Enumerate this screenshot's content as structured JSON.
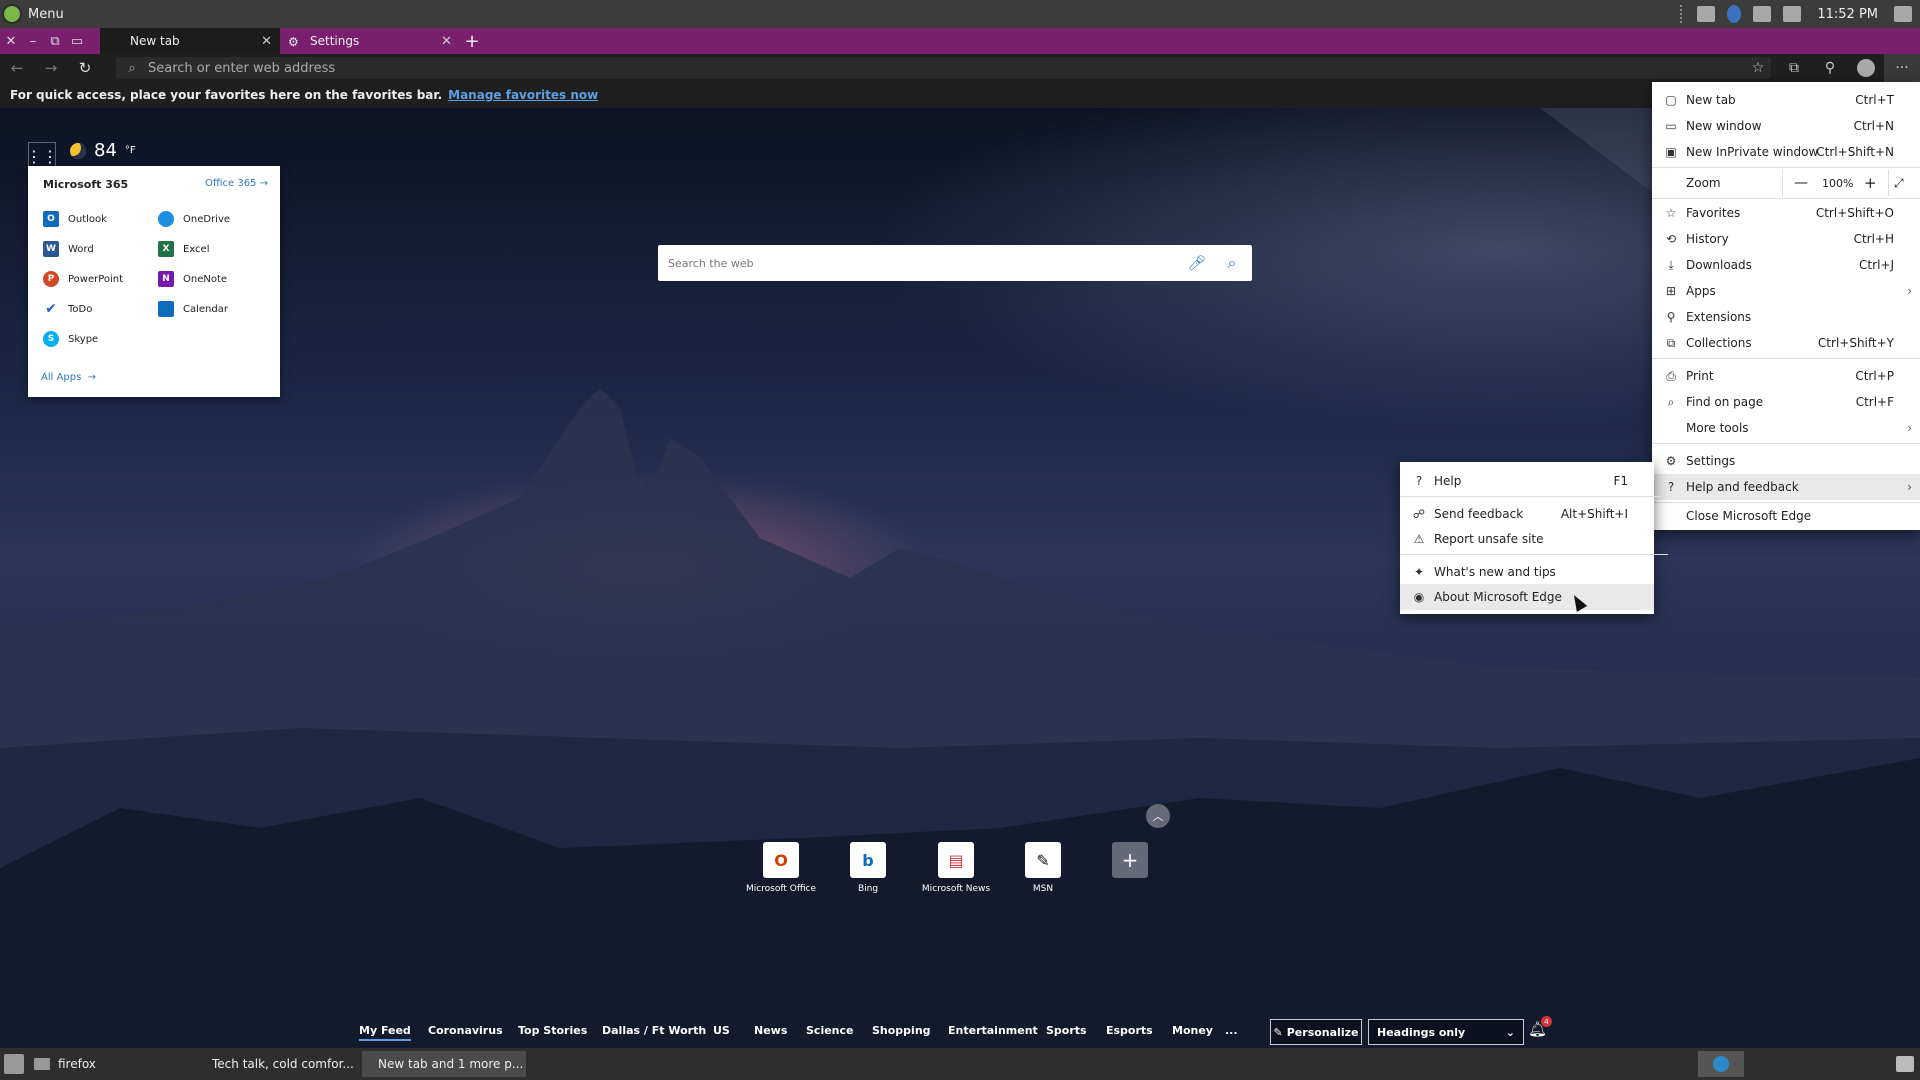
{
  "system": {
    "menu_label": "Menu",
    "clock": "11:52 PM"
  },
  "tabs": [
    {
      "label": "New tab"
    },
    {
      "label": "Settings"
    }
  ],
  "toolbar": {
    "address_placeholder": "Search or enter web address"
  },
  "favbar": {
    "text": "For quick access, place your favorites here on the favorites bar.",
    "link": "Manage favorites now"
  },
  "weather": {
    "temp": "84",
    "unit": "°F"
  },
  "m365": {
    "title": "Microsoft 365",
    "office_link": "Office 365",
    "apps": [
      {
        "label": "Outlook",
        "color": "#0f6cbd"
      },
      {
        "label": "OneDrive",
        "color": "#1c8fe0"
      },
      {
        "label": "Word",
        "color": "#2b5797"
      },
      {
        "label": "Excel",
        "color": "#217346"
      },
      {
        "label": "PowerPoint",
        "color": "#d24726"
      },
      {
        "label": "OneNote",
        "color": "#7719aa"
      },
      {
        "label": "ToDo",
        "color": "#2564cf"
      },
      {
        "label": "Calendar",
        "color": "#0f6cbd"
      },
      {
        "label": "Skype",
        "color": "#00aff0"
      }
    ],
    "all_apps": "All Apps"
  },
  "websearch": {
    "placeholder": "Search the web"
  },
  "quick_links": [
    {
      "label": "Microsoft Office",
      "color": "#d83b01"
    },
    {
      "label": "Bing",
      "color": "#0f6cbd"
    },
    {
      "label": "Microsoft News",
      "color": "#d13438"
    },
    {
      "label": "MSN",
      "color": "#111111"
    }
  ],
  "feed": {
    "items": [
      "My Feed",
      "Coronavirus",
      "Top Stories",
      "Dallas / Ft Worth",
      "US",
      "News",
      "Science",
      "Shopping",
      "Entertainment",
      "Sports",
      "Esports",
      "Money",
      "..."
    ],
    "personalize": "Personalize",
    "layout_select": "Headings only",
    "notifications": "4"
  },
  "taskbar": {
    "folder_label": "firefox",
    "windows": [
      "Tech talk, cold comfor...",
      "New tab and 1 more p..."
    ]
  },
  "menu": {
    "new_tab": {
      "label": "New tab",
      "shortcut": "Ctrl+T"
    },
    "new_window": {
      "label": "New window",
      "shortcut": "Ctrl+N"
    },
    "new_inprivate": {
      "label": "New InPrivate window",
      "shortcut": "Ctrl+Shift+N"
    },
    "zoom": {
      "label": "Zoom",
      "value": "100%"
    },
    "favorites": {
      "label": "Favorites",
      "shortcut": "Ctrl+Shift+O"
    },
    "history": {
      "label": "History",
      "shortcut": "Ctrl+H"
    },
    "downloads": {
      "label": "Downloads",
      "shortcut": "Ctrl+J"
    },
    "apps": {
      "label": "Apps"
    },
    "extensions": {
      "label": "Extensions"
    },
    "collections": {
      "label": "Collections",
      "shortcut": "Ctrl+Shift+Y"
    },
    "print": {
      "label": "Print",
      "shortcut": "Ctrl+P"
    },
    "find": {
      "label": "Find on page",
      "shortcut": "Ctrl+F"
    },
    "more_tools": {
      "label": "More tools"
    },
    "settings": {
      "label": "Settings"
    },
    "help_feedback": {
      "label": "Help and feedback"
    },
    "close_edge": {
      "label": "Close Microsoft Edge"
    }
  },
  "submenu": {
    "help": {
      "label": "Help",
      "shortcut": "F1"
    },
    "send_feedback": {
      "label": "Send feedback",
      "shortcut": "Alt+Shift+I"
    },
    "report_unsafe": {
      "label": "Report unsafe site"
    },
    "whats_new": {
      "label": "What's new and tips"
    },
    "about": {
      "label": "About Microsoft Edge"
    }
  }
}
